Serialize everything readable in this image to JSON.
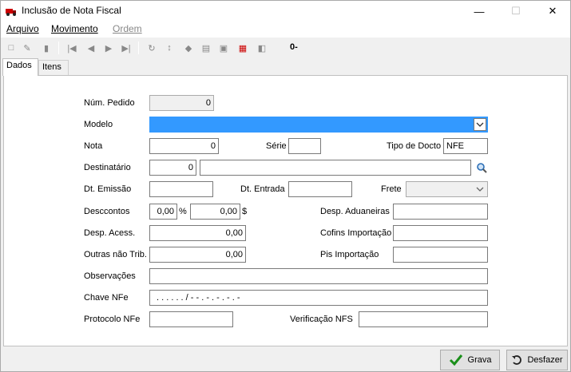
{
  "window": {
    "title": "Inclusão de Nota Fiscal",
    "min": "—",
    "max": "☐",
    "close": "✕"
  },
  "menu": {
    "arquivo": "Arquivo",
    "movimento": "Movimento",
    "ordem": "Ordem"
  },
  "toolbar": {
    "counter": "0-"
  },
  "tabs": {
    "dados": "Dados",
    "itens": "Itens"
  },
  "form": {
    "num_pedido_label": "Núm. Pedido",
    "num_pedido_value": "0",
    "modelo_label": "Modelo",
    "modelo_value": "",
    "nota_label": "Nota",
    "nota_value": "0",
    "serie_label": "Série",
    "serie_value": "",
    "tipo_docto_label": "Tipo de Docto",
    "tipo_docto_value": "NFE",
    "destinatario_label": "Destinatário",
    "destinatario_code": "0",
    "destinatario_name": "",
    "dt_emissao_label": "Dt. Emissão",
    "dt_emissao_value": "",
    "dt_entrada_label": "Dt. Entrada",
    "dt_entrada_value": "",
    "frete_label": "Frete",
    "frete_value": "",
    "descontos_label": "Desccontos",
    "descontos_pct": "0,00",
    "pct_symbol": "%",
    "descontos_val": "0,00",
    "currency_symbol": "$",
    "desp_aduaneiras_label": "Desp. Aduaneiras",
    "desp_aduaneiras_value": "",
    "desp_acess_label": "Desp. Acess.",
    "desp_acess_value": "0,00",
    "cofins_label": "Cofins Importação",
    "cofins_value": "",
    "outras_label": "Outras não Trib.",
    "outras_value": "0,00",
    "pis_label": "Pis Importação",
    "pis_value": "",
    "observacoes_label": "Observações",
    "observacoes_value": "",
    "chave_label": "Chave NFe",
    "chave_value": ". . . . . .  /  - - . - . - . - .   -",
    "protocolo_label": "Protocolo NFe",
    "protocolo_value": "",
    "verificacao_label": "Verificação NFS",
    "verificacao_value": ""
  },
  "buttons": {
    "grava": "Grava",
    "desfazer": "Desfazer"
  },
  "colors": {
    "selection": "#3399ff",
    "check": "#1a8f1a"
  }
}
